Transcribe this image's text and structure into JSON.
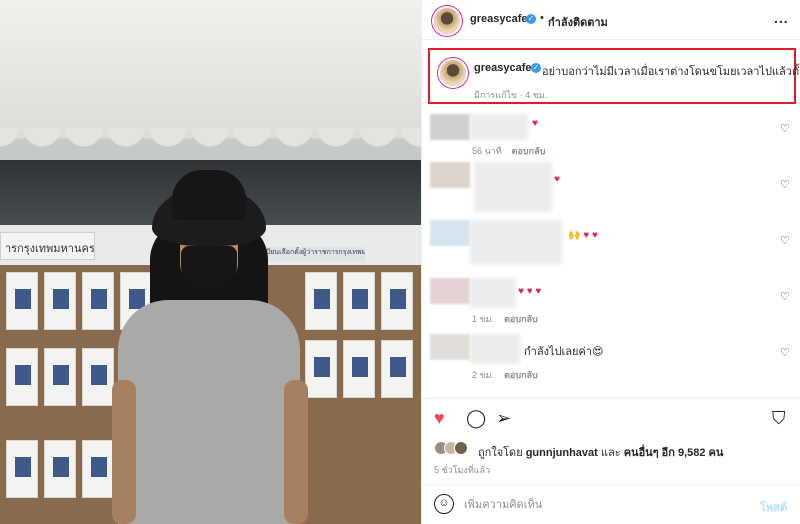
{
  "header": {
    "username": "greasycafe",
    "verified_mark": "✓",
    "separator": "•",
    "follow_status": "กำลังติดตาม",
    "more_icon": "..."
  },
  "caption": {
    "username": "greasycafe",
    "verified_mark": "✓",
    "text": "อย่าบอกว่าไม่มีเวลาเมื่อเราต่างโดนขโมยเวลาไปแล้วตั้งกี่ปี",
    "meta": "มีการแก้ไข · 4 ชม.",
    "highlight_color": "#e21d2b"
  },
  "comments": [
    {
      "text": "",
      "reactions": "♥",
      "time": "56 นาที",
      "reply": "ตอบกลับ"
    },
    {
      "text": "",
      "reactions": "♥",
      "time": "",
      "reply": ""
    },
    {
      "text": "",
      "reactions": "🙌 ♥ ♥",
      "time": "",
      "reply": ""
    },
    {
      "text": "",
      "reactions": "♥ ♥ ♥",
      "time": "1 ชม.",
      "reply": "ตอบกลับ"
    },
    {
      "text": "กำลังไปเลยค่า",
      "reactions": "😍",
      "time": "2 ชม.",
      "reply": "ตอบกลับ"
    }
  ],
  "comment_like_icon": "♡",
  "actions": {
    "like_icon": "♥",
    "comment_icon": "◯",
    "share_icon": "➢",
    "save_icon": "⛉"
  },
  "likes": {
    "prefix": "ถูกใจโดย",
    "user": "gunnjunhavat",
    "and": "และ",
    "others": "คนอื่นๆ อีก 9,582 คน"
  },
  "timestamp": "5 ชั่วโมงที่แล้ว",
  "composer": {
    "emoji_icon": "☺",
    "placeholder": "เพิ่มความคิดเห็น",
    "post_label": "โพสต์"
  },
  "photo": {
    "banner_text": "ารกรุงเทพมหานคร",
    "board_header_text": "ทะเบียนเลือกตั้งผู้ว่าราชการกรุงเทพมหานคร"
  },
  "colors": {
    "like_red": "#ed4956",
    "verified_blue": "#3897f0",
    "post_disabled": "#b2dffc"
  }
}
